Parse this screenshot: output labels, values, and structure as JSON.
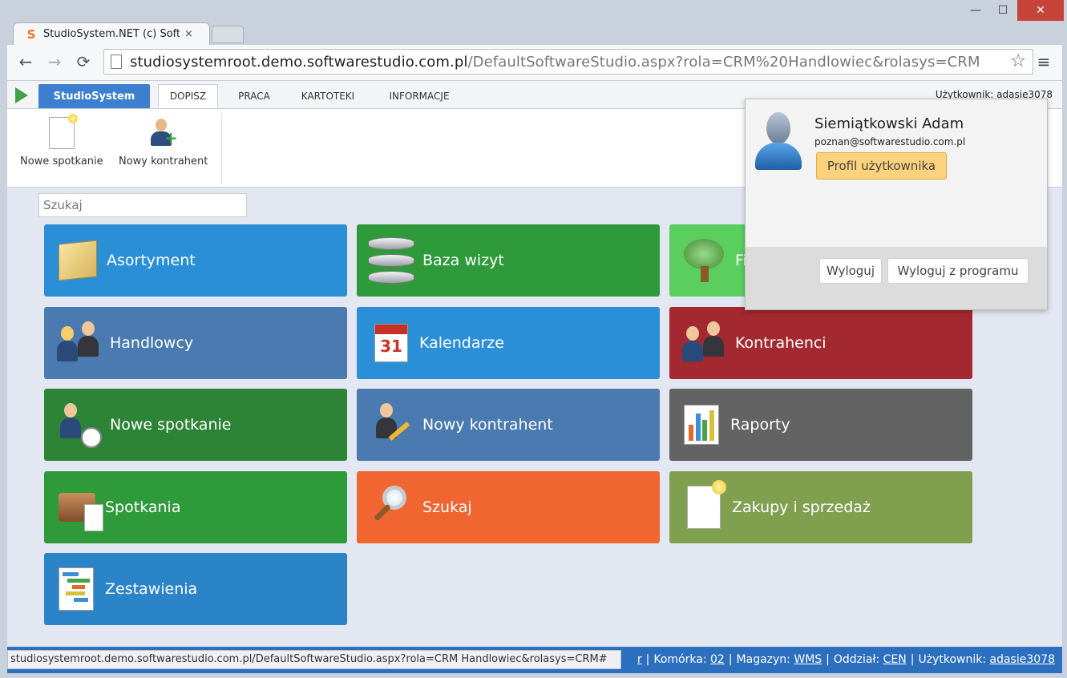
{
  "browser": {
    "tab_title": "StudioSystem.NET (c) Soft",
    "tab_close": "×",
    "favicon": "S",
    "url_host": "studiosystemroot.demo.softwarestudio.com.pl",
    "url_path": "/DefaultSoftwareStudio.aspx?rola=CRM%20Handlowiec&rolasys=CRM",
    "back": "←",
    "forward": "→",
    "reload": "⟳",
    "star": "☆",
    "menu": "≡",
    "minimize": "—",
    "maximize": "☐",
    "close": "✕"
  },
  "app": {
    "brand_button": "StudioSystem",
    "tabs": [
      {
        "label": "DOPISZ"
      },
      {
        "label": "PRACA"
      },
      {
        "label": "KARTOTEKI"
      },
      {
        "label": "INFORMACJE"
      }
    ],
    "user_label": "Użytkownik: adasie3078"
  },
  "ribbon": {
    "items": [
      {
        "label": "Nowe spotkanie",
        "icon": "new-document-icon"
      },
      {
        "label": "Nowy kontrahent",
        "icon": "add-contractor-icon"
      }
    ]
  },
  "search": {
    "placeholder": "Szukaj"
  },
  "tiles": [
    {
      "label": "Asortyment",
      "color": "#2b8fd8",
      "icon": "box-icon"
    },
    {
      "label": "Baza wizyt",
      "color": "#2e9a3a",
      "icon": "database-icon"
    },
    {
      "label": "Fi",
      "color": "#5ace5e",
      "icon": "tree-icon"
    },
    {
      "label": "Handlowcy",
      "color": "#4a7ab0",
      "icon": "salespeople-icon"
    },
    {
      "label": "Kalendarze",
      "color": "#2b8fd8",
      "icon": "calendar-icon"
    },
    {
      "label": "Kontrahenci",
      "color": "#a3282f",
      "icon": "contractors-icon"
    },
    {
      "label": "Nowe spotkanie",
      "color": "#2d8436",
      "icon": "person-clock-icon"
    },
    {
      "label": "Nowy kontrahent",
      "color": "#4a7ab0",
      "icon": "person-pen-icon"
    },
    {
      "label": "Raporty",
      "color": "#636363",
      "icon": "report-chart-icon"
    },
    {
      "label": "Spotkania",
      "color": "#2e9a3a",
      "icon": "briefcase-icon"
    },
    {
      "label": "Szukaj",
      "color": "#f06530",
      "icon": "magnifier-icon"
    },
    {
      "label": "Zakupy i sprzedaż",
      "color": "#80a050",
      "icon": "document-icon"
    },
    {
      "label": "Zestawienia",
      "color": "#2b84c8",
      "icon": "gantt-icon"
    }
  ],
  "calendar_number": "31",
  "user_popup": {
    "name": "Siemiątkowski Adam",
    "email": "poznan@softwarestudio.com.pl",
    "profile_button": "Profil użytkownika",
    "logout_button": "Wyloguj",
    "logout_program_button": "Wyloguj z programu"
  },
  "status": {
    "hover_url": "studiosystemroot.demo.softwarestudio.com.pl/DefaultSoftwareStudio.aspx?rola=CRM Handlowiec&rolasys=CRM#",
    "partial": "r",
    "cell_label": "Komórka:",
    "cell_value": "02",
    "warehouse_label": "Magazyn:",
    "warehouse_value": "WMS",
    "branch_label": "Oddział:",
    "branch_value": "CEN",
    "user_label": "Użytkownik:",
    "user_value": "adasie3078"
  }
}
